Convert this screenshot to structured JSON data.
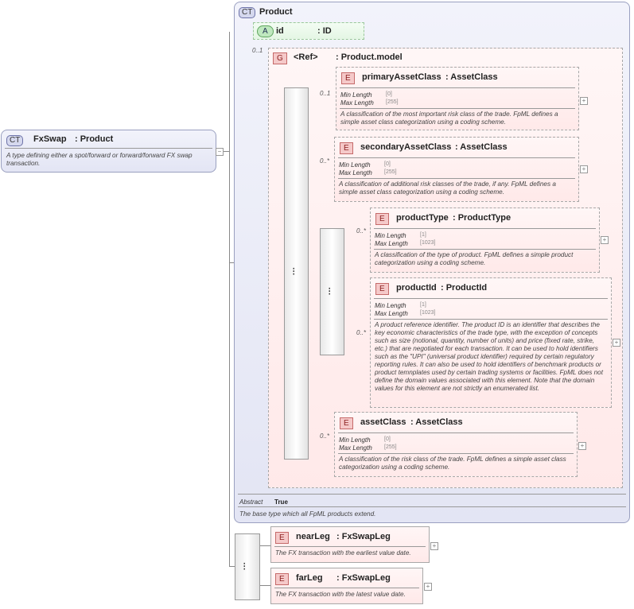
{
  "root": {
    "badge": "CT",
    "name": "FxSwap",
    "type": ": Product",
    "doc": "A type defining either a spot/forward or forward/forward FX swap transaction."
  },
  "product": {
    "badge": "CT",
    "name": "Product",
    "attribute": {
      "badge": "A",
      "name": "id",
      "type": ": ID"
    },
    "group": {
      "badge": "G",
      "name": "<Ref>",
      "type": ": Product.model",
      "multiplicity": "0..1"
    },
    "abstract_label": "Abstract",
    "abstract_value": "True",
    "doc": "The base type which all FpML products extend."
  },
  "elements": [
    {
      "badge": "E",
      "name": "primaryAssetClass",
      "type": ": AssetClass",
      "multiplicity": "0..1",
      "min_label": "Min Length",
      "min_value": "[0]",
      "max_label": "Max Length",
      "max_value": "[255]",
      "doc": "A classification of the most important risk class of the trade. FpML defines a simple asset class categorization using a coding scheme."
    },
    {
      "badge": "E",
      "name": "secondaryAssetClass",
      "type": ": AssetClass",
      "multiplicity": "0..*",
      "min_label": "Min Length",
      "min_value": "[0]",
      "max_label": "Max Length",
      "max_value": "[255]",
      "doc": "A classification of additional risk classes of the trade, if any. FpML defines a simple asset class categorization using a coding scheme."
    },
    {
      "badge": "E",
      "name": "productType",
      "type": ": ProductType",
      "multiplicity": "0..*",
      "min_label": "Min Length",
      "min_value": "[1]",
      "max_label": "Max Length",
      "max_value": "[1023]",
      "doc": "A classification of the type of product. FpML defines a simple product categorization using a coding scheme."
    },
    {
      "badge": "E",
      "name": "productId",
      "type": ": ProductId",
      "multiplicity": "0..*",
      "min_label": "Min Length",
      "min_value": "[1]",
      "max_label": "Max Length",
      "max_value": "[1023]",
      "doc": "A product reference identifier. The product ID is an identifier that describes the key economic characteristics of the trade type, with the exception of concepts such as size (notional, quantity, number of units) and price (fixed rate, strike, etc.) that are negotiated for each transaction. It can be used to hold identifiers such as the \"UPI\" (universal product identifier) required by certain regulatory reporting rules. It can also be used to hold identifiers of benchmark products or product temnplates used by certain trading systems or facilities. FpML does not define the domain values associated with this element. Note that the domain values for this element are not strictly an enumerated list."
    },
    {
      "badge": "E",
      "name": "assetClass",
      "type": ": AssetClass",
      "multiplicity": "0..*",
      "min_label": "Min Length",
      "min_value": "[0]",
      "max_label": "Max Length",
      "max_value": "[255]",
      "doc": "A classification of the risk class of the trade. FpML defines a simple asset class categorization using a coding scheme."
    }
  ],
  "legs": [
    {
      "badge": "E",
      "name": "nearLeg",
      "type": ": FxSwapLeg",
      "doc": "The FX transaction with the earliest value date."
    },
    {
      "badge": "E",
      "name": "farLeg",
      "type": ": FxSwapLeg",
      "doc": "The FX transaction with the latest value date."
    }
  ],
  "ui": {
    "expand_glyph": "+",
    "collapse_glyph": "−",
    "sequence_glyph": "⁝"
  }
}
